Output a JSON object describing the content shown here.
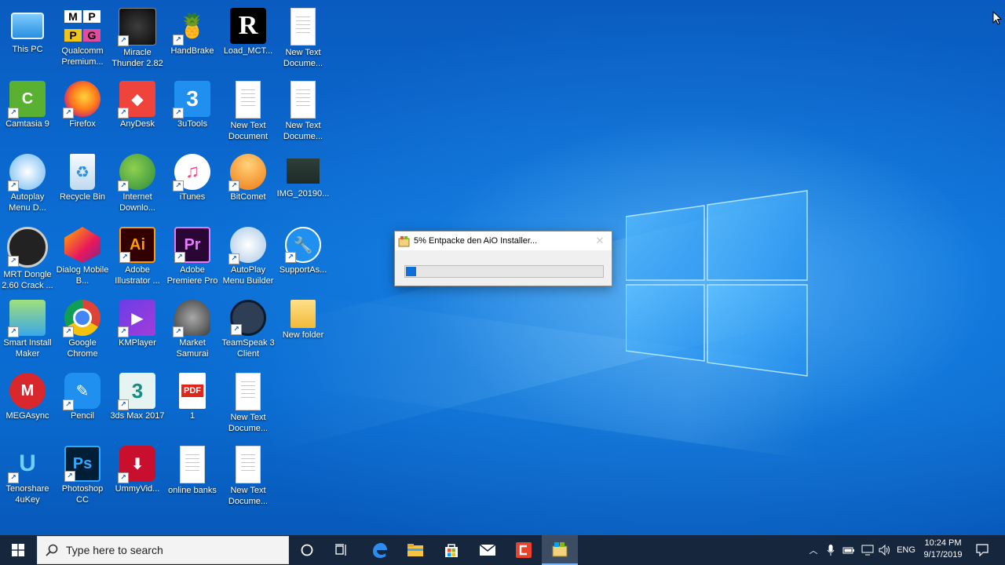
{
  "desktop": {
    "icons": [
      {
        "label": "This PC"
      },
      {
        "label": "Qualcomm Premium..."
      },
      {
        "label": "Miracle Thunder 2.82"
      },
      {
        "label": "HandBrake"
      },
      {
        "label": "Load_MCT..."
      },
      {
        "label": "New Text Docume..."
      },
      {
        "label": "Camtasia 9"
      },
      {
        "label": "Firefox"
      },
      {
        "label": "AnyDesk"
      },
      {
        "label": "3uTools"
      },
      {
        "label": "New Text Document"
      },
      {
        "label": "New Text Docume..."
      },
      {
        "label": "Autoplay Menu D..."
      },
      {
        "label": "Recycle Bin"
      },
      {
        "label": "Internet Downlo..."
      },
      {
        "label": "iTunes"
      },
      {
        "label": "BitComet"
      },
      {
        "label": "IMG_20190..."
      },
      {
        "label": "MRT Dongle 2.60 Crack ..."
      },
      {
        "label": "Dialog Mobile B..."
      },
      {
        "label": "Adobe Illustrator ..."
      },
      {
        "label": "Adobe Premiere Pro"
      },
      {
        "label": "AutoPlay Menu Builder"
      },
      {
        "label": "SupportAs..."
      },
      {
        "label": "Smart Install Maker"
      },
      {
        "label": "Google Chrome"
      },
      {
        "label": "KMPlayer"
      },
      {
        "label": "Market Samurai"
      },
      {
        "label": "TeamSpeak 3 Client"
      },
      {
        "label": "New folder"
      },
      {
        "label": "MEGAsync"
      },
      {
        "label": "Pencil"
      },
      {
        "label": "3ds Max 2017"
      },
      {
        "label": "1"
      },
      {
        "label": "New Text Docume..."
      },
      {
        "label": "Tenorshare 4uKey"
      },
      {
        "label": "Photoshop CC"
      },
      {
        "label": "UmmyVid..."
      },
      {
        "label": "online banks"
      },
      {
        "label": "New Text Docume..."
      }
    ],
    "icon_glyphs": {
      "qualcomm": [
        "M",
        "P",
        "P",
        "G"
      ],
      "load_mct": "R",
      "camtasia": "C",
      "anydesk": "◆",
      "three_u": "3",
      "adobe_ai": "Ai",
      "adobe_pr": "Pr",
      "photoshop": "Ps",
      "mega": "M",
      "max": "3",
      "pdf": "PDF"
    }
  },
  "dialog": {
    "title": "5% Entpacke den AiO Installer...",
    "progress_fraction": 0.05
  },
  "taskbar": {
    "search_placeholder": "Type here to search",
    "language": "ENG",
    "time": "10:24 PM",
    "date": "9/17/2019"
  },
  "colors": {
    "accent": "#0078d7",
    "taskbar": "#16263c"
  }
}
